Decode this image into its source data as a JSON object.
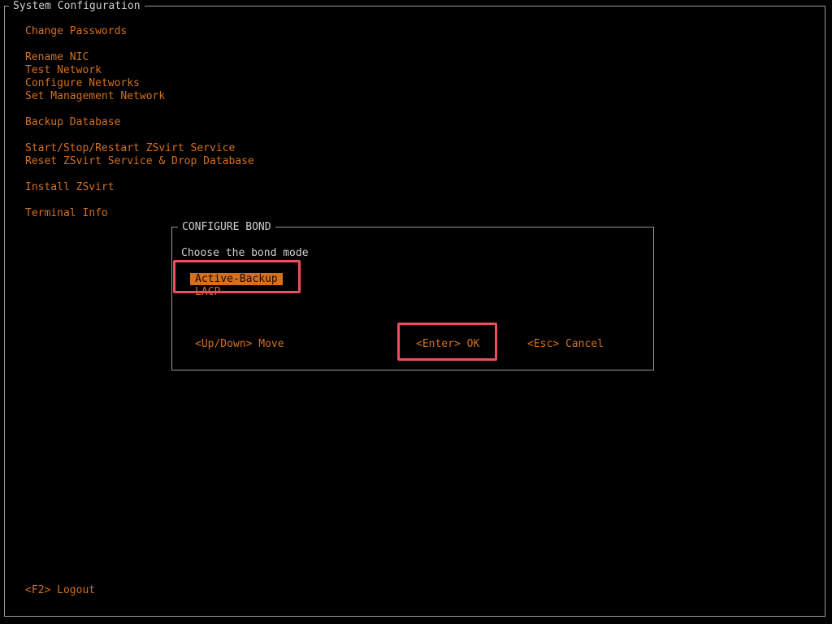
{
  "window": {
    "title": "System Configuration"
  },
  "menu": {
    "items": [
      {
        "label": "Change Passwords"
      },
      {
        "label": "Rename NIC"
      },
      {
        "label": "Test Network"
      },
      {
        "label": "Configure Networks"
      },
      {
        "label": "Set Management Network"
      },
      {
        "label": "Backup Database"
      },
      {
        "label": "Start/Stop/Restart ZSvirt Service"
      },
      {
        "label": "Reset ZSvirt Service & Drop Database"
      },
      {
        "label": "Install ZSvirt"
      },
      {
        "label": "Terminal Info"
      }
    ],
    "logout": "<F2> Logout"
  },
  "dialog": {
    "title": "CONFIGURE BOND",
    "prompt": "Choose the bond mode",
    "options": [
      {
        "label": "Active-Backup",
        "selected": true
      },
      {
        "label": "LACP",
        "selected": false
      }
    ],
    "hint_move": "<Up/Down> Move",
    "ok_label": "<Enter> OK",
    "cancel_label": "<Esc> Cancel"
  },
  "colors": {
    "accent": "#d4701e",
    "frame": "#9a9a9a",
    "title_text": "#cfcfcf",
    "annotation": "#e8505b",
    "background": "#000000"
  }
}
